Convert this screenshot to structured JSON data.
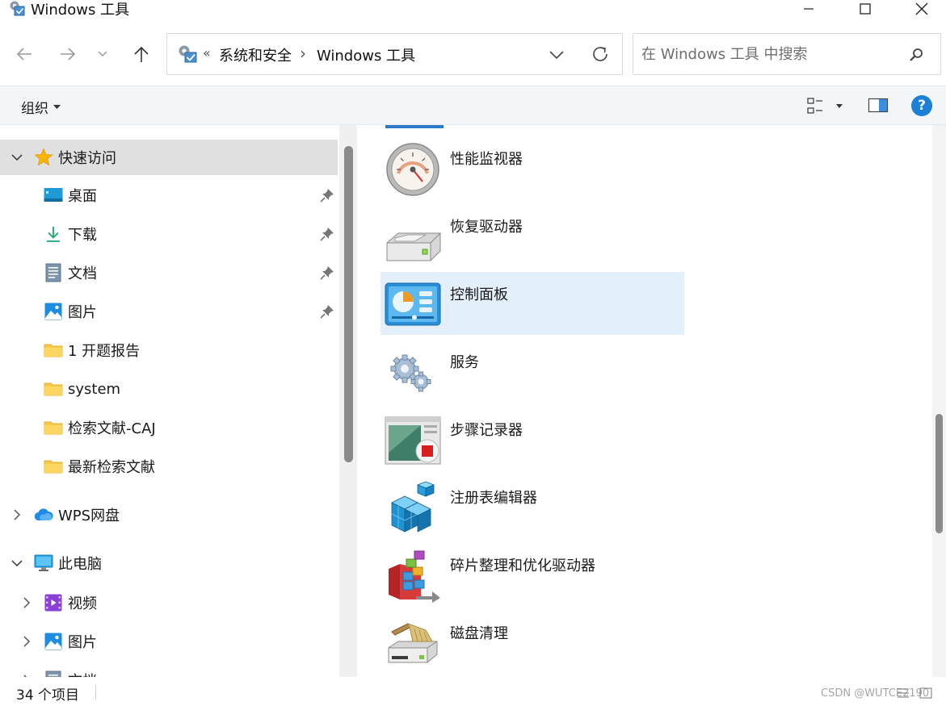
{
  "window": {
    "title": "Windows 工具",
    "icon": "control-panel-tools-icon",
    "controls": [
      "minimize-icon",
      "maximize-icon",
      "close-icon"
    ]
  },
  "address": {
    "overflow": "«",
    "segments": [
      "系统和安全",
      "Windows 工具"
    ],
    "separator": "›",
    "icons": [
      "back-arrow-icon",
      "forward-arrow-icon",
      "history-dropdown-icon",
      "up-arrow-icon",
      "address-dropdown-icon",
      "refresh-icon"
    ]
  },
  "search": {
    "placeholder": "在 Windows 工具 中搜索",
    "value": ""
  },
  "commandbar": {
    "organize_label": "组织",
    "help_label": "?"
  },
  "nav": {
    "quick_access": "快速访问",
    "quick_items": [
      {
        "label": "桌面",
        "icon": "desktop-icon",
        "pinned": true
      },
      {
        "label": "下载",
        "icon": "download-icon",
        "pinned": true
      },
      {
        "label": "文档",
        "icon": "document-icon",
        "pinned": true
      },
      {
        "label": "图片",
        "icon": "pictures-icon",
        "pinned": true
      },
      {
        "label": "1 开题报告",
        "icon": "folder-icon",
        "pinned": false
      },
      {
        "label": "system",
        "icon": "folder-icon",
        "pinned": false
      },
      {
        "label": "检索文献-CAJ",
        "icon": "folder-icon",
        "pinned": false
      },
      {
        "label": "最新检索文献",
        "icon": "folder-icon",
        "pinned": false
      }
    ],
    "wps": "WPS网盘",
    "this_pc": "此电脑",
    "pc_items": [
      {
        "label": "视频",
        "icon": "videos-icon"
      },
      {
        "label": "图片",
        "icon": "pictures-icon"
      },
      {
        "label": "文档",
        "icon": "document-icon"
      }
    ]
  },
  "content": {
    "items": [
      {
        "label": "性能监视器",
        "icon": "performance-monitor-icon",
        "selected": false
      },
      {
        "label": "恢复驱动器",
        "icon": "recovery-drive-icon",
        "selected": false
      },
      {
        "label": "控制面板",
        "icon": "control-panel-icon",
        "selected": true
      },
      {
        "label": "服务",
        "icon": "services-icon",
        "selected": false
      },
      {
        "label": "步骤记录器",
        "icon": "steps-recorder-icon",
        "selected": false
      },
      {
        "label": "注册表编辑器",
        "icon": "registry-editor-icon",
        "selected": false
      },
      {
        "label": "碎片整理和优化驱动器",
        "icon": "defragment-icon",
        "selected": false
      },
      {
        "label": "磁盘清理",
        "icon": "disk-cleanup-icon",
        "selected": false
      }
    ]
  },
  "status": {
    "count": "34 个项目",
    "watermark": "CSDN @WUTCE2190"
  },
  "colors": {
    "accent": "#1c7fd8",
    "selection_content": "#e3f0fb",
    "selection_nav": "#e0e0e0",
    "folder": "#f7c948"
  }
}
